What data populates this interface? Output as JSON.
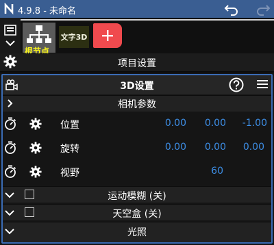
{
  "app": {
    "title": "4.9.8 - 未命名"
  },
  "nodes": [
    {
      "label": "根节点"
    },
    {
      "label": "文字3D"
    }
  ],
  "project": {
    "title": "项目设置"
  },
  "panel": {
    "title": "3D设置",
    "camera_section": "相机参数",
    "params": [
      {
        "label": "位置",
        "values": [
          "0.00",
          "0.00",
          "-1.00"
        ]
      },
      {
        "label": "旋转",
        "values": [
          "0.00",
          "0.00",
          "0.00"
        ]
      },
      {
        "label": "视野",
        "values": [
          "60"
        ]
      }
    ],
    "sections": [
      {
        "label": "运动模糊 (关)",
        "has_checkbox": true
      },
      {
        "label": "天空盒 (关)",
        "has_checkbox": true
      },
      {
        "label": "光照",
        "has_checkbox": false
      }
    ]
  },
  "colors": {
    "titlebar": "#3a5e92",
    "accent_value": "#3d8ee6",
    "root_label": "#f7f31e",
    "add_button": "#f04a4e",
    "panel_border": "#3a6cb5"
  },
  "icons": [
    "app-logo-icon",
    "undo-icon",
    "redo-icon",
    "menu-icon",
    "chevron-down-icon",
    "hierarchy-icon",
    "plus-icon",
    "gear-icon",
    "camera-icon",
    "help-icon",
    "hamburger-icon",
    "chevron-right-icon",
    "stopwatch-icon",
    "checkbox-icon"
  ]
}
